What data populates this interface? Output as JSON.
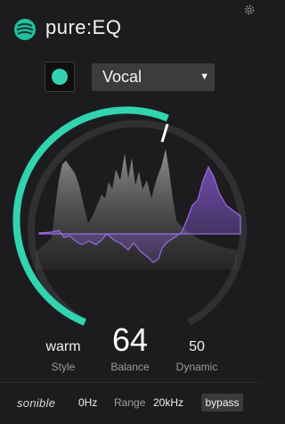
{
  "header": {
    "app_title": "pure:EQ",
    "logo_icon": "sonible-logo-icon",
    "settings_icon": "gear-icon"
  },
  "controls": {
    "profile_selected": "Vocal",
    "source_indicator_color": "#30d4b0"
  },
  "dial": {
    "track_color": "#303033",
    "value_arc_color": "#30d4b0",
    "indicator_color": "#ffffff",
    "spectrum_color": "#9a9a9c",
    "eq_curve_color": "#8a5bd8"
  },
  "parameters": {
    "style": {
      "value": "warm",
      "label": "Style"
    },
    "balance": {
      "value": "64",
      "label": "Balance"
    },
    "dynamic": {
      "value": "50",
      "label": "Dynamic"
    }
  },
  "footer": {
    "brand": "sonible",
    "range_low": "0Hz",
    "range_label": "Range",
    "range_high": "20kHz",
    "bypass_label": "bypass"
  }
}
